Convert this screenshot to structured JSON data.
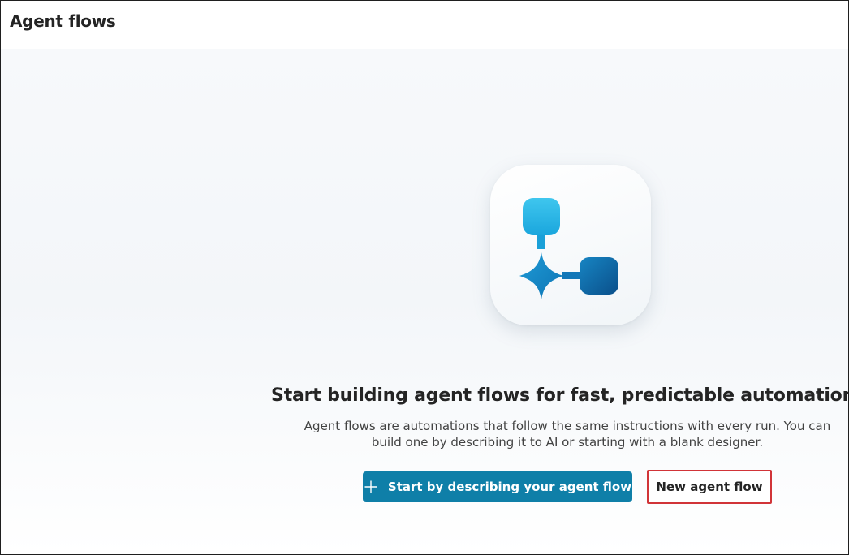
{
  "header": {
    "title": "Agent flows"
  },
  "hero": {
    "icon": "agent-flow-icon"
  },
  "empty_state": {
    "headline": "Start building agent flows for fast, predictable automations",
    "description": "Agent flows are automations that follow the same instructions with every run. You can build one by describing it to AI or starting with a blank designer."
  },
  "actions": {
    "primary_label": "Start by describing your agent flow",
    "primary_icon": "plus-icon",
    "secondary_label": "New agent flow"
  },
  "colors": {
    "primary_button": "#0f7fa8",
    "highlight_border": "#d13438",
    "icon_light": "#39c0ea",
    "icon_dark": "#0d5f9a"
  }
}
